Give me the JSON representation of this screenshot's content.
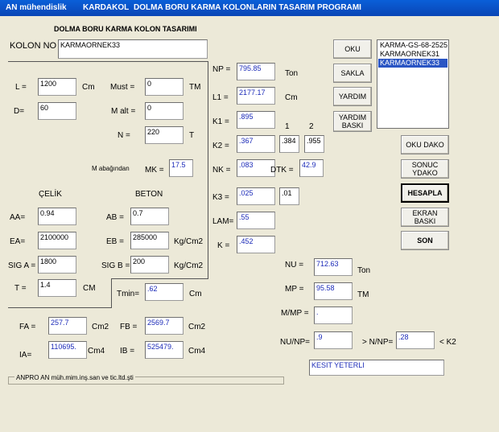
{
  "titlebar": {
    "app": "AN mühendislik",
    "module": "KARDAKOL",
    "program": "DOLMA BORU KARMA KOLONLARIN  TASARIM  PROGRAMI"
  },
  "header": {
    "title": "DOLMA BORU KARMA KOLON TASARIMI"
  },
  "kolon": {
    "label": "KOLON NO",
    "value": "KARMAORNEK33"
  },
  "inputs": {
    "L": {
      "label": "L =",
      "value": "1200",
      "unit": "Cm"
    },
    "D": {
      "label": "D=",
      "value": "60"
    },
    "Must": {
      "label": "Must =",
      "value": "0",
      "unit": "TM"
    },
    "Malt": {
      "label": "M alt =",
      "value": "0"
    },
    "N": {
      "label": "N =",
      "value": "220",
      "unit": "T"
    },
    "MK": {
      "label": "M abağından",
      "label2": "MK =",
      "value": "17.5"
    }
  },
  "materials": {
    "celik": "ÇELİK",
    "beton": "BETON",
    "AA": {
      "label": "AA=",
      "value": "0.94"
    },
    "AB": {
      "label": "AB =",
      "value": "0.7"
    },
    "EA": {
      "label": "EA=",
      "value": "2100000"
    },
    "EB": {
      "label": "EB =",
      "value": "285000",
      "unit": "Kg/Cm2"
    },
    "SIGA": {
      "label": "SIG A =",
      "value": "1800"
    },
    "SIGB": {
      "label": "SIG B =",
      "value": "200",
      "unit": "Kg/Cm2"
    },
    "T": {
      "label": "T =",
      "value": "1.4",
      "unit": "CM"
    }
  },
  "results": {
    "NP": {
      "label": "NP =",
      "value": "795.85",
      "unit": "Ton"
    },
    "L1": {
      "label": "L1 =",
      "value": "2177.17",
      "unit": "Cm"
    },
    "K1": {
      "label": "K1 =",
      "value": ".895"
    },
    "col1": "1",
    "col2": "2",
    "K2": {
      "label": "K2 =",
      "value": ".367",
      "value1": ".384",
      "value2": ".955"
    },
    "NK": {
      "label": "NK =",
      "value": ".083"
    },
    "DTK": {
      "label": "DTK =",
      "value": "42.9"
    },
    "K3": {
      "label": "K3 =",
      "value": ".025",
      "value2": ".01"
    },
    "LAM": {
      "label": "LAM=",
      "value": ".55"
    },
    "K": {
      "label": "K =",
      "value": ".452"
    },
    "Tmin": {
      "label": "Tmin=",
      "value": ".62",
      "unit": "Cm"
    }
  },
  "section": {
    "FA": {
      "label": "FA =",
      "value": "257.7",
      "unit": "Cm2"
    },
    "FB": {
      "label": "FB =",
      "value": "2569.7",
      "unit": "Cm2"
    },
    "IA": {
      "label": "IA=",
      "value": "110695.",
      "unit": "Cm4"
    },
    "IB": {
      "label": "IB =",
      "value": "525479.",
      "unit": "Cm4"
    }
  },
  "check": {
    "NU": {
      "label": "NU =",
      "value": "712.63",
      "unit": "Ton"
    },
    "MP": {
      "label": "MP =",
      "value": "95.58",
      "unit": "TM"
    },
    "MMP": {
      "label": "M/MP =",
      "value": "."
    },
    "NUNP": {
      "label": "NU/NP=",
      "value": ".9"
    },
    "NNP": {
      "label": "> N/NP=",
      "value": ".28",
      "suffix": "< K2"
    },
    "result": "KESIT YETERLI"
  },
  "buttons": {
    "oku": "OKU",
    "sakla": "SAKLA",
    "yardim": "YARDIM",
    "yardim_baski_1": "YARDIM",
    "yardim_baski_2": "BASKI",
    "oku_dako": "OKU DAKO",
    "sonuc_1": "SONUC",
    "sonuc_2": "YDAKO",
    "hesapla": "HESAPLA",
    "ekran_baski": "EKRAN BASKI",
    "son": "SON"
  },
  "list": {
    "items": [
      "KARMA-GS-68-2525",
      "KARMAORNEK31",
      "KARMAORNEK33"
    ]
  },
  "footer": {
    "company": "ANPRO    AN müh.mim.inş.san ve tic.ltd.şti"
  }
}
